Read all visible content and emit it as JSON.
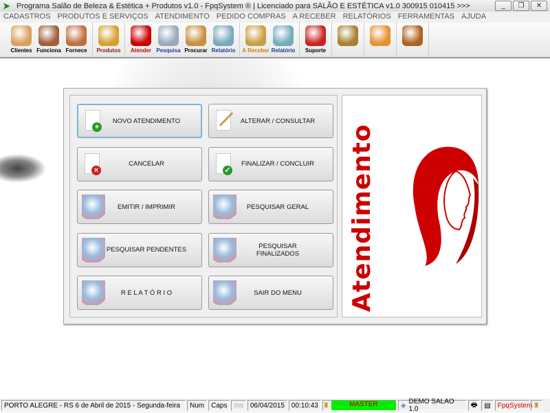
{
  "window": {
    "title": "Programa Salão de Beleza & Estética + Produtos v1.0 - FpqSystem ® | Licenciado para  SALÃO E ESTÉTICA v1.0 300915 010415 >>>",
    "minimize": "_",
    "restore": "❐",
    "close": "✕"
  },
  "menu": [
    "CADASTROS",
    "PRODUTOS E SERVIÇOS",
    "ATENDIMENTO",
    "PEDIDO COMPRAS",
    "A RECEBER",
    "RELATÓRIOS",
    "FERRAMENTAS",
    "AJUDA"
  ],
  "toolbar": [
    {
      "group": [
        {
          "label": "Clientes",
          "color": "#000000",
          "icon": "users-icon"
        },
        {
          "label": "Funciona",
          "color": "#000000",
          "icon": "employees-icon"
        },
        {
          "label": "Fornece",
          "color": "#000000",
          "icon": "supplier-icon"
        }
      ]
    },
    {
      "group": [
        {
          "label": "Produtos",
          "color": "#8b1a1a",
          "icon": "boxes-icon"
        }
      ]
    },
    {
      "group": [
        {
          "label": "Atender",
          "color": "#cc0000",
          "icon": "woman-profile-icon"
        },
        {
          "label": "Pesquisa",
          "color": "#1a3a9a",
          "icon": "search-docs-icon"
        },
        {
          "label": "Procurar",
          "color": "#000000",
          "icon": "file-drawer-icon"
        },
        {
          "label": "Relatório",
          "color": "#1a3a9a",
          "icon": "printer-icon"
        }
      ]
    },
    {
      "group": [
        {
          "label": "A Receber",
          "color": "#d08000",
          "icon": "money-bag-icon"
        },
        {
          "label": "Relatório",
          "color": "#1a3a9a",
          "icon": "printer-icon"
        }
      ]
    },
    {
      "group": [
        {
          "label": "Suporte",
          "color": "#000000",
          "icon": "support-agent-icon"
        }
      ]
    },
    {
      "group": [
        {
          "label": "",
          "color": "#000000",
          "icon": "coin-icon"
        }
      ]
    },
    {
      "group": [
        {
          "label": "",
          "color": "#000000",
          "icon": "calculator-icon"
        }
      ]
    },
    {
      "group": [
        {
          "label": "",
          "color": "#000000",
          "icon": "exit-door-icon"
        }
      ]
    }
  ],
  "buttons": [
    {
      "label": "NOVO ATENDIMENTO",
      "icon": "new-document-icon"
    },
    {
      "label": "ALTERAR  /  CONSULTAR",
      "icon": "pencil-icon"
    },
    {
      "label": "CANCELAR",
      "icon": "cancel-document-icon"
    },
    {
      "label": "FINALIZAR  /  CONCLUIR",
      "icon": "check-document-icon"
    },
    {
      "label": "EMITIR  /  IMPRIMIR",
      "icon": "person-print-icon"
    },
    {
      "label": "PESQUISAR GERAL",
      "icon": "search-chart-icon"
    },
    {
      "label": "PESQUISAR PENDENTES",
      "icon": "search-chart-icon"
    },
    {
      "label": "PESQUISAR FINALIZADOS",
      "icon": "search-chart-icon"
    },
    {
      "label": "R E L A T Ó R I O",
      "icon": "printer-icon"
    },
    {
      "label": "SAIR DO MENU",
      "icon": "exit-icon"
    }
  ],
  "side_panel": {
    "title": "Atendimento",
    "accent": "#cc0000"
  },
  "status": {
    "location": "PORTO ALEGRE - RS  6 de Abril de 2015 - Segunda-feira",
    "num": "Num",
    "caps": "Caps",
    "ins": "Ins",
    "date": "06/04/2015",
    "time": "00:10:43",
    "user": "MASTER",
    "user_color": "#00ee00",
    "database": "DEMO SALAO 1.0",
    "brand": "FpqSystem",
    "brand_color": "#cc0000"
  }
}
